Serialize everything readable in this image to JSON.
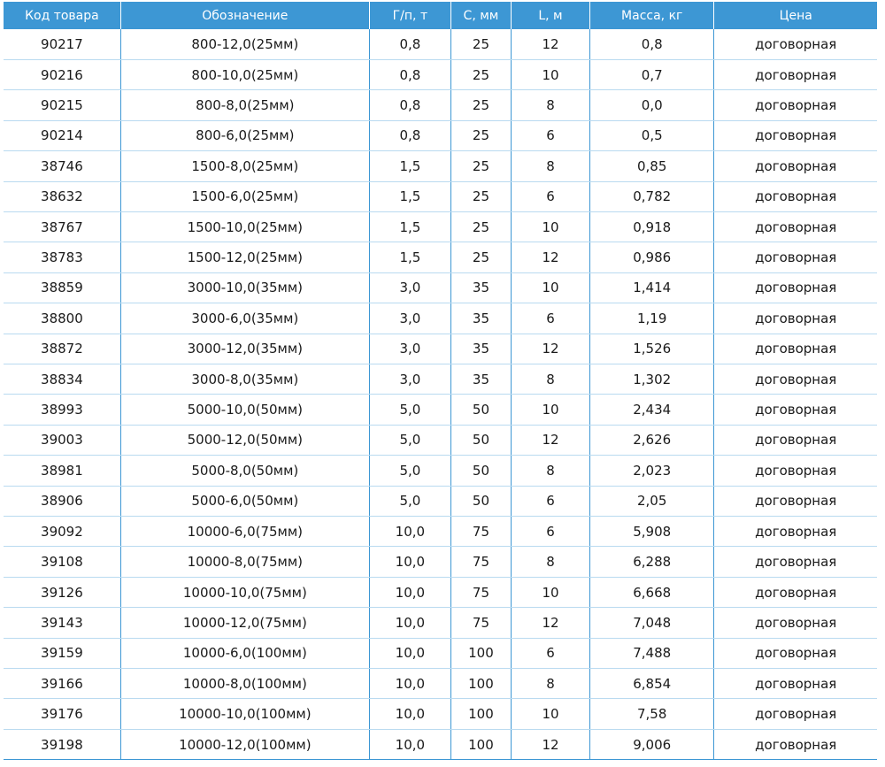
{
  "table": {
    "headers": [
      "Код товара",
      "Обозначение",
      "Г/п, т",
      "С, мм",
      "L, м",
      "Масса, кг",
      "Цена"
    ],
    "rows": [
      [
        "90217",
        "800-12,0(25мм)",
        "0,8",
        "25",
        "12",
        "0,8",
        "договорная"
      ],
      [
        "90216",
        "800-10,0(25мм)",
        "0,8",
        "25",
        "10",
        "0,7",
        "договорная"
      ],
      [
        "90215",
        "800-8,0(25мм)",
        "0,8",
        "25",
        "8",
        "0,0",
        "договорная"
      ],
      [
        "90214",
        "800-6,0(25мм)",
        "0,8",
        "25",
        "6",
        "0,5",
        "договорная"
      ],
      [
        "38746",
        "1500-8,0(25мм)",
        "1,5",
        "25",
        "8",
        "0,85",
        "договорная"
      ],
      [
        "38632",
        "1500-6,0(25мм)",
        "1,5",
        "25",
        "6",
        "0,782",
        "договорная"
      ],
      [
        "38767",
        "1500-10,0(25мм)",
        "1,5",
        "25",
        "10",
        "0,918",
        "договорная"
      ],
      [
        "38783",
        "1500-12,0(25мм)",
        "1,5",
        "25",
        "12",
        "0,986",
        "договорная"
      ],
      [
        "38859",
        "3000-10,0(35мм)",
        "3,0",
        "35",
        "10",
        "1,414",
        "договорная"
      ],
      [
        "38800",
        "3000-6,0(35мм)",
        "3,0",
        "35",
        "6",
        "1,19",
        "договорная"
      ],
      [
        "38872",
        "3000-12,0(35мм)",
        "3,0",
        "35",
        "12",
        "1,526",
        "договорная"
      ],
      [
        "38834",
        "3000-8,0(35мм)",
        "3,0",
        "35",
        "8",
        "1,302",
        "договорная"
      ],
      [
        "38993",
        "5000-10,0(50мм)",
        "5,0",
        "50",
        "10",
        "2,434",
        "договорная"
      ],
      [
        "39003",
        "5000-12,0(50мм)",
        "5,0",
        "50",
        "12",
        "2,626",
        "договорная"
      ],
      [
        "38981",
        "5000-8,0(50мм)",
        "5,0",
        "50",
        "8",
        "2,023",
        "договорная"
      ],
      [
        "38906",
        "5000-6,0(50мм)",
        "5,0",
        "50",
        "6",
        "2,05",
        "договорная"
      ],
      [
        "39092",
        "10000-6,0(75мм)",
        "10,0",
        "75",
        "6",
        "5,908",
        "договорная"
      ],
      [
        "39108",
        "10000-8,0(75мм)",
        "10,0",
        "75",
        "8",
        "6,288",
        "договорная"
      ],
      [
        "39126",
        "10000-10,0(75мм)",
        "10,0",
        "75",
        "10",
        "6,668",
        "договорная"
      ],
      [
        "39143",
        "10000-12,0(75мм)",
        "10,0",
        "75",
        "12",
        "7,048",
        "договорная"
      ],
      [
        "39159",
        "10000-6,0(100мм)",
        "10,0",
        "100",
        "6",
        "7,488",
        "договорная"
      ],
      [
        "39166",
        "10000-8,0(100мм)",
        "10,0",
        "100",
        "8",
        "6,854",
        "договорная"
      ],
      [
        "39176",
        "10000-10,0(100мм)",
        "10,0",
        "100",
        "10",
        "7,58",
        "договорная"
      ],
      [
        "39198",
        "10000-12,0(100мм)",
        "10,0",
        "100",
        "12",
        "9,006",
        "договорная"
      ]
    ]
  },
  "colors": {
    "header_bg": "#3d97d4",
    "header_text": "#ffffff",
    "cell_text": "#1a1a1a",
    "row_divider": "#b9daf0",
    "column_divider": "#3d97d4"
  }
}
